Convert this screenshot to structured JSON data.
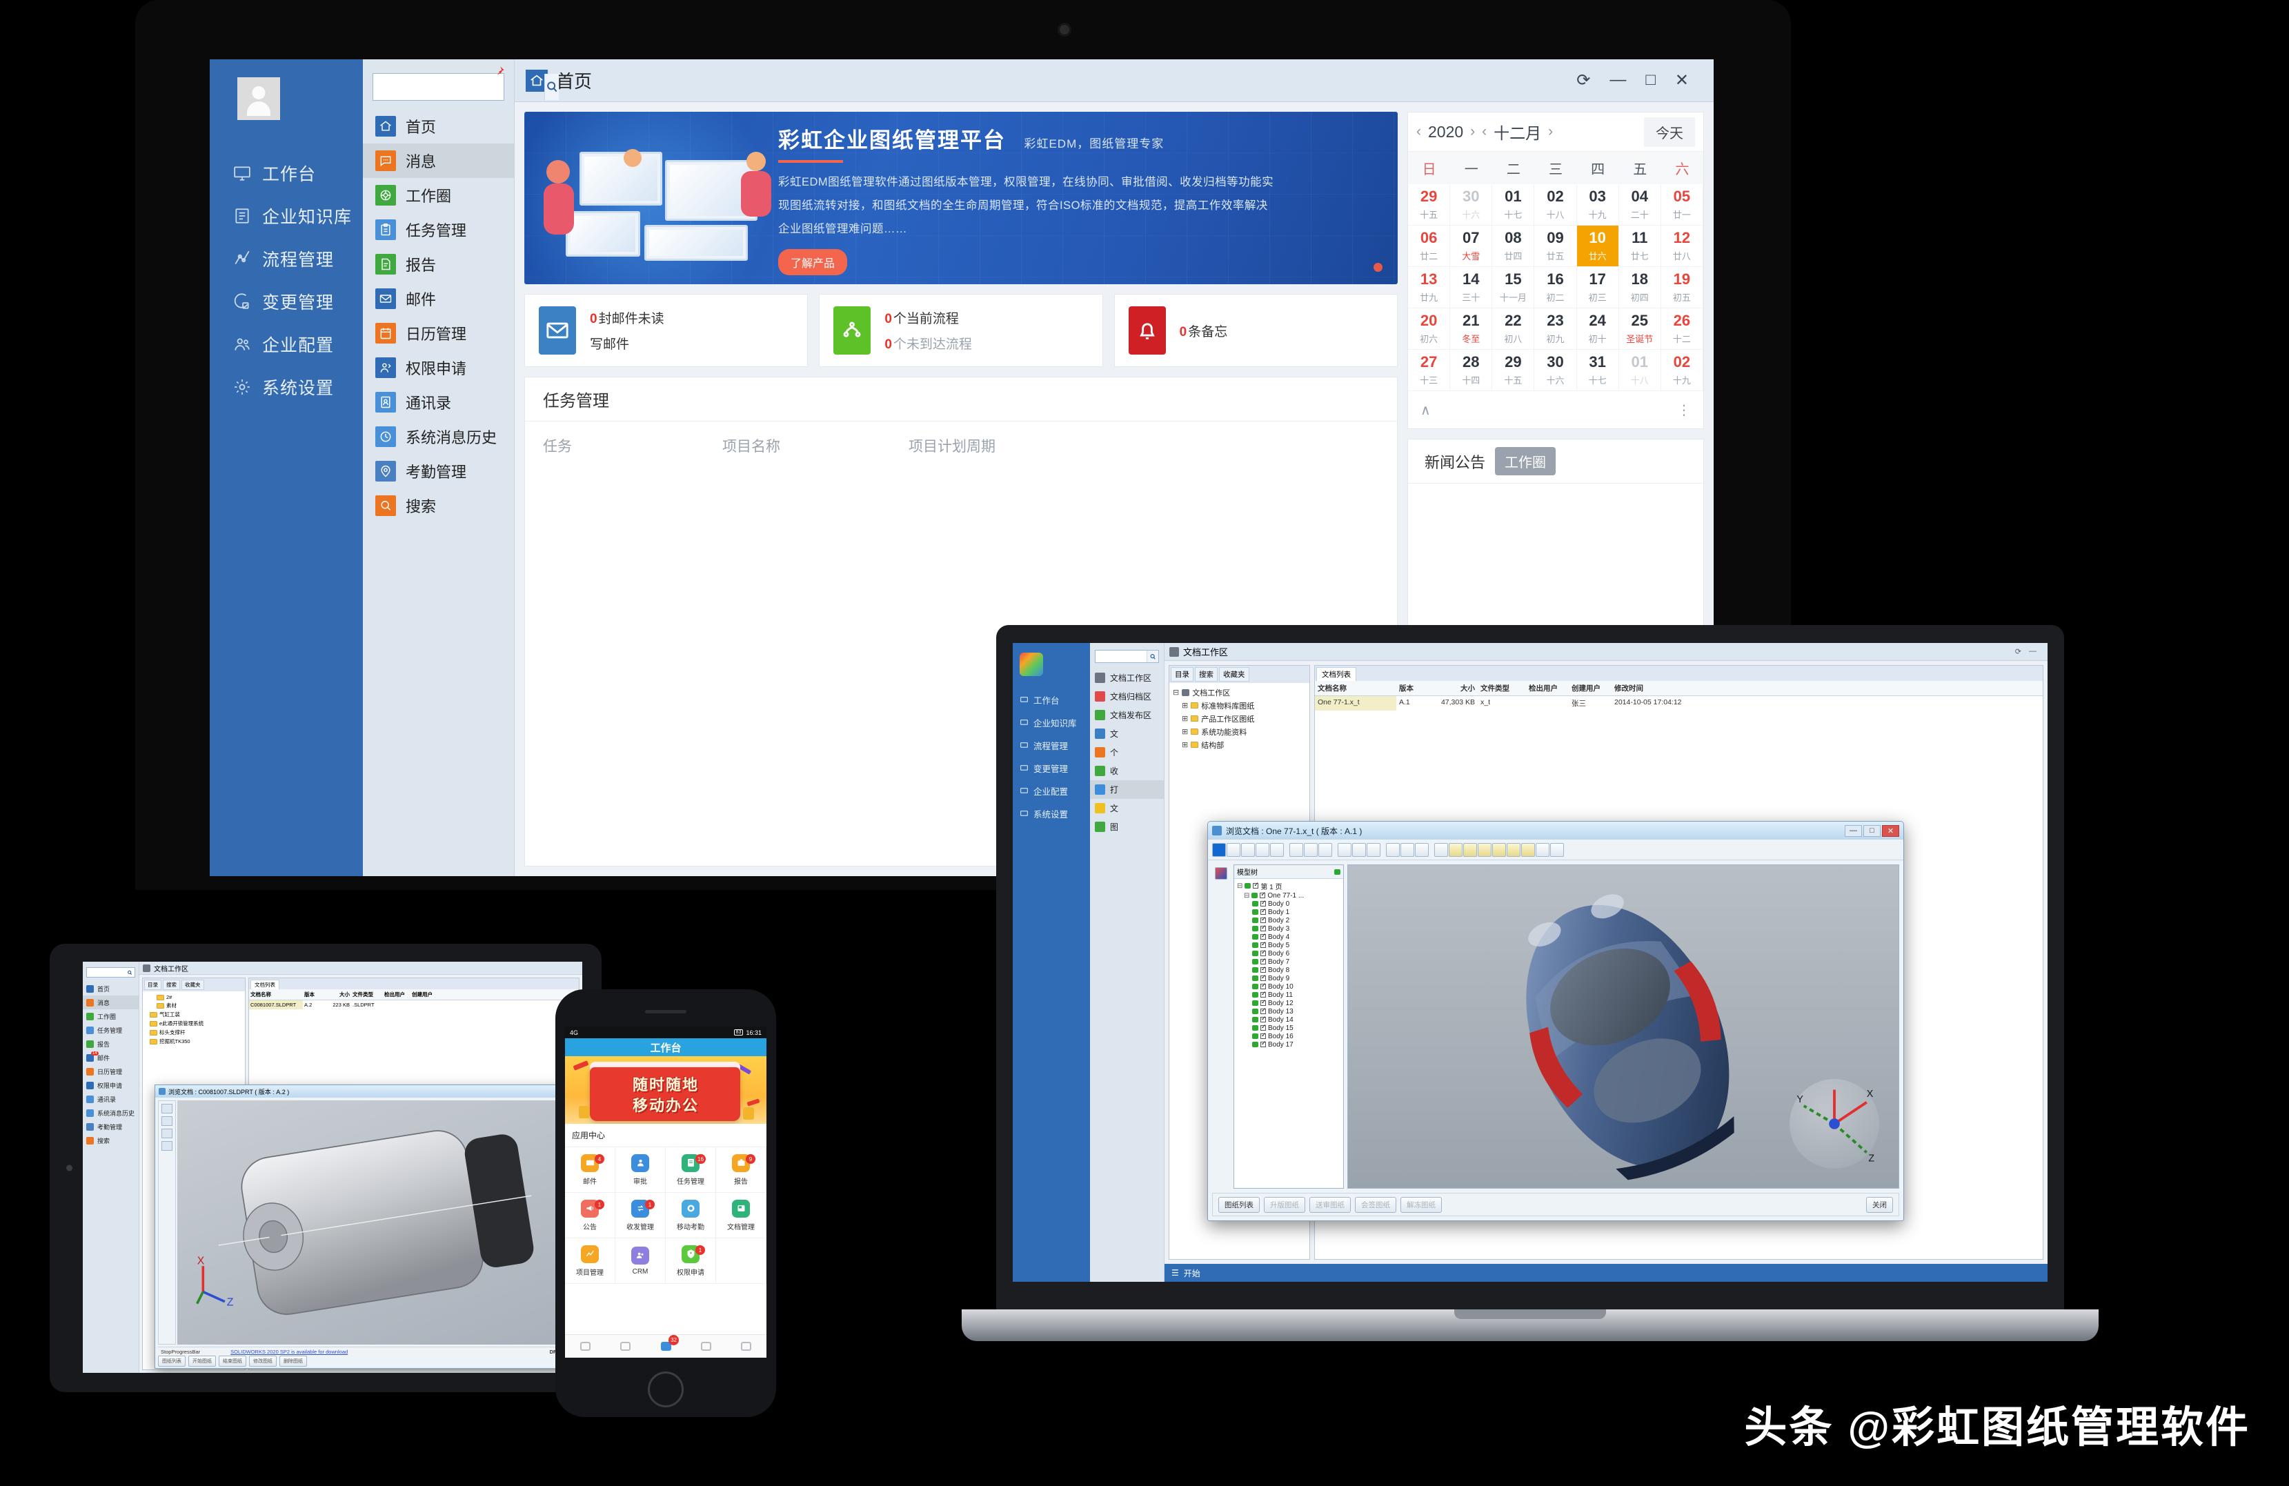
{
  "desktop": {
    "window_title": "首页",
    "window_buttons": [
      "⟳",
      "—",
      "□",
      "✕"
    ],
    "sidebar": {
      "avatar": "user-avatar",
      "items": [
        {
          "label": "工作台",
          "icon": "monitor-icon"
        },
        {
          "label": "企业知识库",
          "icon": "book-icon"
        },
        {
          "label": "流程管理",
          "icon": "flow-icon"
        },
        {
          "label": "变更管理",
          "icon": "change-icon"
        },
        {
          "label": "企业配置",
          "icon": "users-icon"
        },
        {
          "label": "系统设置",
          "icon": "gear-icon"
        }
      ]
    },
    "menu": {
      "search_placeholder": "",
      "search_value": "",
      "items": [
        {
          "label": "首页",
          "color": "#2f6cb5",
          "icon": "home-icon",
          "active": false
        },
        {
          "label": "消息",
          "color": "#ec7522",
          "icon": "chat-icon",
          "active": true
        },
        {
          "label": "工作圈",
          "color": "#3fa93f",
          "icon": "circle-icon",
          "active": false
        },
        {
          "label": "任务管理",
          "color": "#4a90d9",
          "icon": "clipboard-icon",
          "active": false
        },
        {
          "label": "报告",
          "color": "#3fa93f",
          "icon": "report-icon",
          "active": false
        },
        {
          "label": "邮件",
          "color": "#2f6cb5",
          "icon": "mail-icon",
          "active": false
        },
        {
          "label": "日历管理",
          "color": "#ec7522",
          "icon": "calendar-icon",
          "active": false
        },
        {
          "label": "权限申请",
          "color": "#2f6cb5",
          "icon": "permission-icon",
          "active": false
        },
        {
          "label": "通讯录",
          "color": "#4a90d9",
          "icon": "contacts-icon",
          "active": false
        },
        {
          "label": "系统消息历史",
          "color": "#4a90d9",
          "icon": "clock-icon",
          "active": false
        },
        {
          "label": "考勤管理",
          "color": "#4a7fc1",
          "icon": "location-icon",
          "active": false
        },
        {
          "label": "搜索",
          "color": "#ec7522",
          "icon": "search-icon",
          "active": false
        }
      ]
    },
    "hero": {
      "title": "彩虹企业图纸管理平台",
      "subtitle": "彩虹EDM，图纸管理专家",
      "paragraph": "彩虹EDM图纸管理软件通过图纸版本管理，权限管理，在线协同、审批借阅、收发归档等功能实现图纸流转对接，和图纸文档的全生命周期管理，符合ISO标准的文档规范，提高工作效率解决企业图纸管理难问题……",
      "button": "了解产品"
    },
    "stats": [
      {
        "count": "0",
        "line1_suffix": "封邮件未读",
        "line2": "写邮件",
        "color": "#3b82c4",
        "icon": "mail-icon"
      },
      {
        "count": "0",
        "line1_suffix": "个当前流程",
        "count2": "0",
        "line2_suffix": "个未到达流程",
        "color": "#5ec128",
        "icon": "flow-icon"
      },
      {
        "count": "0",
        "line1_suffix": "条备忘",
        "color": "#cf2026",
        "icon": "bell-icon"
      }
    ],
    "task_panel": {
      "title": "任务管理",
      "columns": [
        "任务",
        "项目名称",
        "项目计划周期"
      ],
      "rows": []
    },
    "news_panel": {
      "title": "新闻公告",
      "tab": "工作圈"
    },
    "calendar": {
      "year": "2020",
      "month": "十二月",
      "today_button": "今天",
      "weekdays": [
        "日",
        "一",
        "二",
        "三",
        "四",
        "五",
        "六"
      ],
      "days": [
        {
          "d": "29",
          "l": "十五",
          "wk": true,
          "out": false
        },
        {
          "d": "30",
          "l": "十六",
          "out": true
        },
        {
          "d": "01",
          "l": "十七"
        },
        {
          "d": "02",
          "l": "十八"
        },
        {
          "d": "03",
          "l": "十九"
        },
        {
          "d": "04",
          "l": "二十"
        },
        {
          "d": "05",
          "l": "廿一",
          "wk": true
        },
        {
          "d": "06",
          "l": "廿二",
          "wk": true
        },
        {
          "d": "07",
          "l": "大雪",
          "fest": true
        },
        {
          "d": "08",
          "l": "廿四"
        },
        {
          "d": "09",
          "l": "廿五"
        },
        {
          "d": "10",
          "l": "廿六",
          "sel": true
        },
        {
          "d": "11",
          "l": "廿七"
        },
        {
          "d": "12",
          "l": "廿八",
          "wk": true
        },
        {
          "d": "13",
          "l": "廿九",
          "wk": true
        },
        {
          "d": "14",
          "l": "三十"
        },
        {
          "d": "15",
          "l": "十一月"
        },
        {
          "d": "16",
          "l": "初二"
        },
        {
          "d": "17",
          "l": "初三"
        },
        {
          "d": "18",
          "l": "初四"
        },
        {
          "d": "19",
          "l": "初五",
          "wk": true
        },
        {
          "d": "20",
          "l": "初六",
          "wk": true
        },
        {
          "d": "21",
          "l": "冬至",
          "fest": true
        },
        {
          "d": "22",
          "l": "初八"
        },
        {
          "d": "23",
          "l": "初九"
        },
        {
          "d": "24",
          "l": "初十"
        },
        {
          "d": "25",
          "l": "圣诞节",
          "fest": true
        },
        {
          "d": "26",
          "l": "十二",
          "wk": true
        },
        {
          "d": "27",
          "l": "十三",
          "wk": true
        },
        {
          "d": "28",
          "l": "十四"
        },
        {
          "d": "29",
          "l": "十五"
        },
        {
          "d": "30",
          "l": "十六"
        },
        {
          "d": "31",
          "l": "十七"
        },
        {
          "d": "01",
          "l": "十八",
          "out": true
        },
        {
          "d": "02",
          "l": "十九",
          "wk": true
        }
      ]
    }
  },
  "laptop": {
    "sidebar_items": [
      "工作台",
      "企业知识库",
      "流程管理",
      "变更管理",
      "企业配置",
      "系统设置"
    ],
    "menu_items": [
      {
        "label": "文档工作区",
        "color": "#6b7480"
      },
      {
        "label": "文档归档区",
        "color": "#e04a4a"
      },
      {
        "label": "文档发布区",
        "color": "#3fa93f"
      },
      {
        "label": "文",
        "color": "#3b7fc4"
      },
      {
        "label": "个",
        "color": "#ec7522"
      },
      {
        "label": "收",
        "color": "#3fa93f"
      },
      {
        "label": "打",
        "color": "#3b8ede"
      },
      {
        "label": "文",
        "color": "#f0c020"
      },
      {
        "label": "图",
        "color": "#3fa93f"
      }
    ],
    "window_title": "文档工作区",
    "tree_tabs": [
      "目录",
      "搜索",
      "收藏夹"
    ],
    "tree_root": "文档工作区",
    "tree_nodes": [
      "标准物料库图纸",
      "产品工作区图纸",
      "系统功能资料",
      "结构部"
    ],
    "list_tab": "文档列表",
    "list_columns": [
      "文档名称",
      "版本",
      "大小",
      "文件类型",
      "检出用户",
      "创建用户",
      "修改时间"
    ],
    "list_rows": [
      {
        "name": "One 77-1.x_t",
        "version": "A.1",
        "size": "47,303 KB",
        "type": "x_t",
        "checkout": "",
        "creator": "张三",
        "modified": "2014-10-05 17:04:12"
      }
    ],
    "taskbar_start": "开始",
    "dialog": {
      "title": "浏览文档 : One 77-1.x_t ( 版本 : A.1 )",
      "tree_header": "模型树",
      "tree_root": "第 1 页",
      "tree_sub": "One 77-1 ...",
      "bodies": [
        "Body 0",
        "Body 1",
        "Body 2",
        "Body 3",
        "Body 4",
        "Body 5",
        "Body 6",
        "Body 7",
        "Body 8",
        "Body 9",
        "Body 10",
        "Body 11",
        "Body 12",
        "Body 13",
        "Body 14",
        "Body 15",
        "Body 16",
        "Body 17"
      ],
      "footer_buttons": [
        "图纸列表",
        "升版图纸",
        "送审图纸",
        "会签图纸",
        "解冻图纸"
      ],
      "close_button": "关闭",
      "window_buttons": [
        "—",
        "□",
        "✕"
      ]
    }
  },
  "tablet": {
    "menu_items": [
      {
        "label": "首页"
      },
      {
        "label": "消息",
        "active": true
      },
      {
        "label": "工作圈"
      },
      {
        "label": "任务管理"
      },
      {
        "label": "报告"
      },
      {
        "label": "邮件",
        "badge": "14"
      },
      {
        "label": "日历管理"
      },
      {
        "label": "权限申请"
      },
      {
        "label": "通讯录"
      },
      {
        "label": "系统消息历史"
      },
      {
        "label": "考勤管理"
      },
      {
        "label": "搜索"
      }
    ],
    "window_title": "文档工作区",
    "tabs": [
      "目录",
      "搜索",
      "收藏夹"
    ],
    "tree_nodes": [
      "2#",
      "素材",
      "气缸工装",
      "e此通开锁管理系统",
      "标头支撑杆",
      "挖掘机TK350"
    ],
    "list_tab": "文档列表",
    "list_columns": [
      "文档名称",
      "版本",
      "大小",
      "文件类型",
      "检出用户",
      "创建用户"
    ],
    "list_rows": [
      {
        "name": "C0081007.SLDPRT",
        "version": "A.2",
        "size": "223 KB",
        "type": ".SLDPRT"
      }
    ],
    "dialog_title": "浏览文档 : C0081007.SLDPRT ( 版本 : A.2 )",
    "status_left": "StopProgressBar",
    "status_center": "SOLIDWORKS 2020 SP2 is available for download",
    "status_right": "DRAWIN",
    "footer_buttons": [
      "图纸列表",
      "开始图纸",
      "结束图纸",
      "修改图纸",
      "删除图纸"
    ]
  },
  "phone": {
    "status_left": "4G",
    "status_right": "16:31",
    "battery": "83",
    "header": "工作台",
    "banner_line1": "随时随地",
    "banner_line2": "移动办公",
    "section_title": "应用中心",
    "apps": [
      {
        "label": "邮件",
        "badge": "4",
        "color": "#f5a623",
        "icon": "mail-icon"
      },
      {
        "label": "审批",
        "badge": "",
        "color": "#3b8ede",
        "icon": "approve-icon"
      },
      {
        "label": "任务管理",
        "badge": "16",
        "color": "#2fb37a",
        "icon": "task-icon"
      },
      {
        "label": "报告",
        "badge": "9",
        "color": "#f5a623",
        "icon": "report-icon"
      },
      {
        "label": "公告",
        "badge": "1",
        "color": "#ef6e5e",
        "icon": "megaphone-icon"
      },
      {
        "label": "收发管理",
        "badge": "1",
        "color": "#3b8ede",
        "icon": "exchange-icon"
      },
      {
        "label": "移动考勤",
        "badge": "",
        "color": "#4aa8e0",
        "icon": "fingerprint-icon"
      },
      {
        "label": "文档管理",
        "badge": "",
        "color": "#2fb37a",
        "icon": "doc-icon"
      },
      {
        "label": "项目管理",
        "badge": "",
        "color": "#f5a623",
        "icon": "chart-icon"
      },
      {
        "label": "CRM",
        "badge": "",
        "color": "#8d7ee0",
        "icon": "crm-icon"
      },
      {
        "label": "权限申请",
        "badge": "1",
        "color": "#5cc83c",
        "icon": "key-icon"
      }
    ],
    "tabbar_badge": "32"
  },
  "watermark": "头条 @彩虹图纸管理软件"
}
